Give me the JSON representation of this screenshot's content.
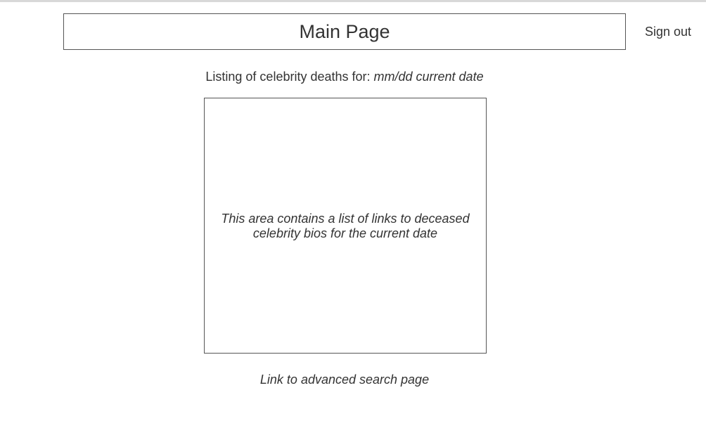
{
  "header": {
    "title": "Main Page",
    "sign_out_label": "Sign out"
  },
  "listing": {
    "prefix": "Listing of celebrity deaths for: ",
    "date_placeholder": "mm/dd current date"
  },
  "list_area": {
    "description": "This area contains a list of links to deceased celebrity bios for the current date"
  },
  "footer": {
    "advanced_search_link": "Link to advanced search page"
  }
}
